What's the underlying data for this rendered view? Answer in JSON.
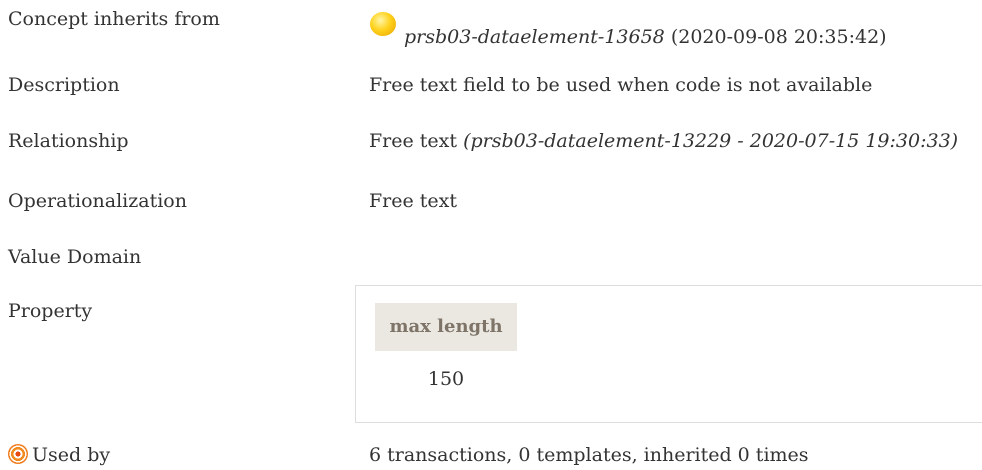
{
  "rows": {
    "inherits": {
      "label": "Concept inherits from",
      "ref_id": "prsb03-dataelement-13658",
      "ref_date": "(2020-09-08 20:35:42)",
      "icon": "yellow-status-orb-icon"
    },
    "description": {
      "label": "Description",
      "value": "Free text field to be used when code is not available"
    },
    "relationship": {
      "label": "Relationship",
      "value": "Free text",
      "ref": "(prsb03-dataelement-13229 - 2020-07-15 19:30:33)"
    },
    "operationalization": {
      "label": "Operationalization",
      "value": "Free text"
    },
    "value_domain": {
      "label": "Value Domain"
    },
    "property": {
      "label": "Property",
      "table": {
        "header": "max length",
        "value": "150"
      }
    },
    "used_by": {
      "label": "Used by",
      "icon": "target-icon",
      "value": "6 transactions, 0 templates, inherited 0 times"
    }
  },
  "colors": {
    "text": "#333333",
    "table_header_bg": "#ebe8e2",
    "table_header_text": "#7f7468",
    "orb": "#ffd21c",
    "target": "#f07b1a"
  }
}
